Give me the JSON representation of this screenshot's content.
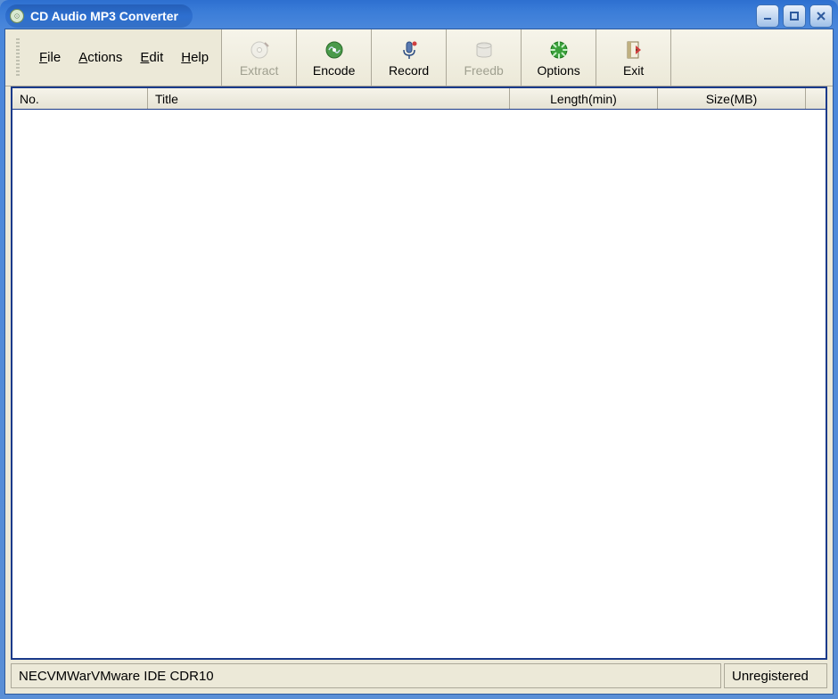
{
  "window": {
    "title": "CD Audio MP3 Converter"
  },
  "menubar": {
    "file": "File",
    "actions": "Actions",
    "edit": "Edit",
    "help": "Help"
  },
  "toolbar": {
    "extract": "Extract",
    "encode": "Encode",
    "record": "Record",
    "freedb": "Freedb",
    "options": "Options",
    "exit": "Exit"
  },
  "columns": {
    "no": "No.",
    "title": "Title",
    "length": "Length(min)",
    "size": "Size(MB)"
  },
  "status": {
    "device": "NECVMWarVMware IDE CDR10",
    "registration": "Unregistered"
  }
}
